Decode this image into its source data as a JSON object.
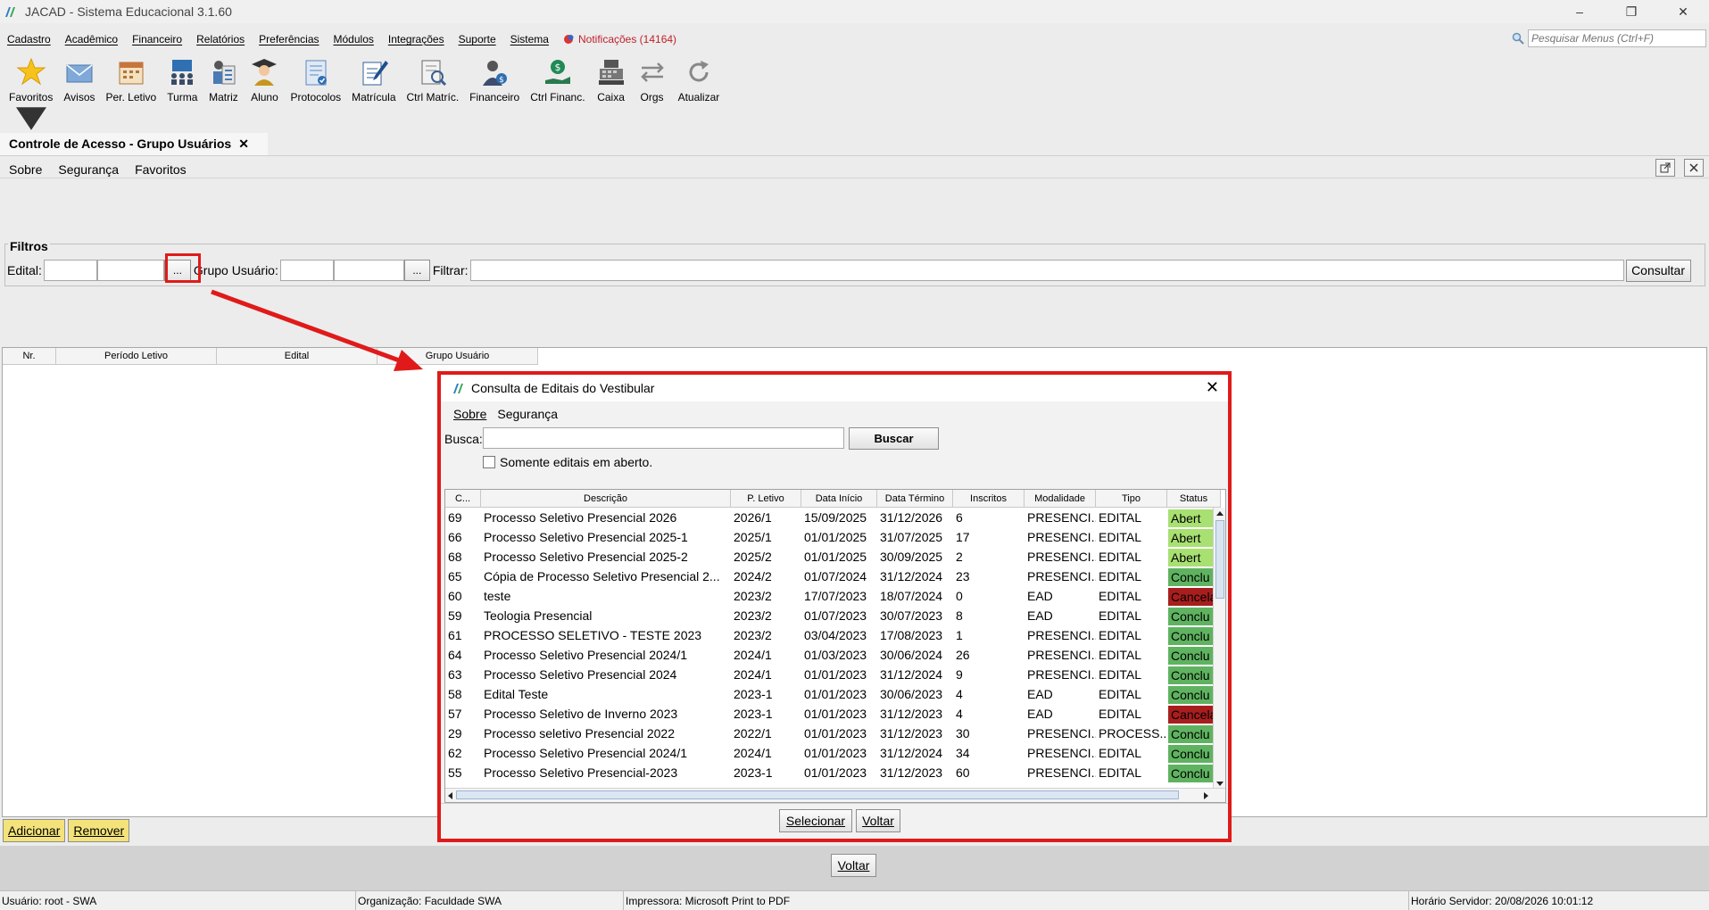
{
  "window": {
    "title": "JACAD - Sistema Educacional 3.1.60",
    "minimize": "–",
    "maximize": "❐",
    "close": "✕"
  },
  "menu": {
    "items": [
      "Cadastro",
      "Acadêmico",
      "Financeiro",
      "Relatórios",
      "Preferências",
      "Módulos",
      "Integrações",
      "Suporte",
      "Sistema"
    ],
    "notifications": "Notificações (14164)",
    "search_placeholder": "Pesquisar Menus (Ctrl+F)"
  },
  "toolbar": {
    "favoritos": "Favoritos",
    "avisos": "Avisos",
    "per_letivo": "Per. Letivo",
    "turma": "Turma",
    "matriz": "Matriz",
    "aluno": "Aluno",
    "protocolos": "Protocolos",
    "matricula": "Matrícula",
    "ctrl_matric": "Ctrl Matríc.",
    "financeiro": "Financeiro",
    "ctrl_financ": "Ctrl Financ.",
    "caixa": "Caixa",
    "orgs": "Orgs",
    "atualizar": "Atualizar"
  },
  "tab": {
    "title": "Controle de Acesso - Grupo Usuários",
    "close": "✕"
  },
  "submenu": {
    "sobre": "Sobre",
    "seguranca": "Segurança",
    "favoritos": "Favoritos"
  },
  "filters": {
    "legend": "Filtros",
    "edital_label": "Edital:",
    "grupo_label": "Grupo Usuário:",
    "filtrar_label": "Filtrar:",
    "dots": "...",
    "consultar": "Consultar"
  },
  "main_table": {
    "headers": [
      "Nr.",
      "Período Letivo",
      "Edital",
      "Grupo Usuário"
    ]
  },
  "buttons": {
    "adicionar": "Adicionar",
    "remover": "Remover",
    "voltar": "Voltar"
  },
  "status_bar": {
    "usuario": "Usuário: root - SWA",
    "organizacao": "Organização: Faculdade SWA",
    "impressora": "Impressora: Microsoft Print to PDF",
    "horario": "Horário Servidor: 20/08/2026 10:01:12"
  },
  "dialog": {
    "title": "Consulta de Editais do Vestibular",
    "close": "✕",
    "menu_sobre": "Sobre",
    "menu_seguranca": "Segurança",
    "busca_label": "Busca:",
    "buscar": "Buscar",
    "checkbox": "Somente editais em aberto.",
    "selecionar": "Selecionar",
    "voltar": "Voltar",
    "headers": [
      "C...",
      "Descrição",
      "P. Letivo",
      "Data Início",
      "Data Término",
      "Inscritos",
      "Modalidade",
      "Tipo",
      "Status"
    ],
    "rows": [
      {
        "c": "69",
        "descricao": "Processo Seletivo Presencial 2026",
        "letivo": "2026/1",
        "inicio": "15/09/2025",
        "termino": "31/12/2026",
        "inscritos": "6",
        "modalidade": "PRESENCI...",
        "tipo": "EDITAL",
        "status": "Abert",
        "status_kind": "aberto"
      },
      {
        "c": "66",
        "descricao": "Processo Seletivo Presencial 2025-1",
        "letivo": "2025/1",
        "inicio": "01/01/2025",
        "termino": "31/07/2025",
        "inscritos": "17",
        "modalidade": "PRESENCI...",
        "tipo": "EDITAL",
        "status": "Abert",
        "status_kind": "aberto"
      },
      {
        "c": "68",
        "descricao": "Processo Seletivo Presencial 2025-2",
        "letivo": "2025/2",
        "inicio": "01/01/2025",
        "termino": "30/09/2025",
        "inscritos": "2",
        "modalidade": "PRESENCI...",
        "tipo": "EDITAL",
        "status": "Abert",
        "status_kind": "aberto"
      },
      {
        "c": "65",
        "descricao": "Cópia de Processo Seletivo Presencial 2...",
        "letivo": "2024/2",
        "inicio": "01/07/2024",
        "termino": "31/12/2024",
        "inscritos": "23",
        "modalidade": "PRESENCI...",
        "tipo": "EDITAL",
        "status": "Conclu",
        "status_kind": "concluido"
      },
      {
        "c": "60",
        "descricao": "teste",
        "letivo": "2023/2",
        "inicio": "17/07/2023",
        "termino": "18/07/2024",
        "inscritos": "0",
        "modalidade": "EAD",
        "tipo": "EDITAL",
        "status": "Cancela",
        "status_kind": "cancelado"
      },
      {
        "c": "59",
        "descricao": "Teologia Presencial",
        "letivo": "2023/2",
        "inicio": "01/07/2023",
        "termino": "30/07/2023",
        "inscritos": "8",
        "modalidade": "EAD",
        "tipo": "EDITAL",
        "status": "Conclu",
        "status_kind": "concluido"
      },
      {
        "c": "61",
        "descricao": "PROCESSO SELETIVO - TESTE 2023",
        "letivo": "2023/2",
        "inicio": "03/04/2023",
        "termino": "17/08/2023",
        "inscritos": "1",
        "modalidade": "PRESENCI...",
        "tipo": "EDITAL",
        "status": "Conclu",
        "status_kind": "concluido"
      },
      {
        "c": "64",
        "descricao": "Processo Seletivo Presencial 2024/1",
        "letivo": "2024/1",
        "inicio": "01/03/2023",
        "termino": "30/06/2024",
        "inscritos": "26",
        "modalidade": "PRESENCI...",
        "tipo": "EDITAL",
        "status": "Conclu",
        "status_kind": "concluido"
      },
      {
        "c": "63",
        "descricao": " Processo Seletivo Presencial 2024",
        "letivo": "2024/1",
        "inicio": "01/01/2023",
        "termino": "31/12/2024",
        "inscritos": "9",
        "modalidade": "PRESENCI...",
        "tipo": "EDITAL",
        "status": "Conclu",
        "status_kind": "concluido"
      },
      {
        "c": "58",
        "descricao": "Edital Teste",
        "letivo": "2023-1",
        "inicio": "01/01/2023",
        "termino": "30/06/2023",
        "inscritos": "4",
        "modalidade": "EAD",
        "tipo": "EDITAL",
        "status": "Conclu",
        "status_kind": "concluido"
      },
      {
        "c": "57",
        "descricao": "Processo Seletivo de Inverno 2023",
        "letivo": "2023-1",
        "inicio": "01/01/2023",
        "termino": "31/12/2023",
        "inscritos": "4",
        "modalidade": "EAD",
        "tipo": "EDITAL",
        "status": "Cancela",
        "status_kind": "cancelado"
      },
      {
        "c": "29",
        "descricao": "Processo seletivo Presencial 2022",
        "letivo": "2022/1",
        "inicio": "01/01/2023",
        "termino": "31/12/2023",
        "inscritos": "30",
        "modalidade": "PRESENCI...",
        "tipo": "PROCESS...",
        "status": "Conclu",
        "status_kind": "concluido"
      },
      {
        "c": "62",
        "descricao": "Processo Seletivo Presencial 2024/1",
        "letivo": "2024/1",
        "inicio": "01/01/2023",
        "termino": "31/12/2024",
        "inscritos": "34",
        "modalidade": "PRESENCI...",
        "tipo": "EDITAL",
        "status": "Conclu",
        "status_kind": "concluido"
      },
      {
        "c": "55",
        "descricao": "Processo Seletivo Presencial-2023",
        "letivo": "2023-1",
        "inicio": "01/01/2023",
        "termino": "31/12/2023",
        "inscritos": "60",
        "modalidade": "PRESENCI...",
        "tipo": "EDITAL",
        "status": "Conclu",
        "status_kind": "concluido"
      }
    ]
  },
  "colors": {
    "highlight_red": "#e01a1a",
    "aberto": "#a8e072",
    "concluido": "#5fb360",
    "cancelado": "#a81e1e",
    "button_yellow": "#f3e37a"
  }
}
